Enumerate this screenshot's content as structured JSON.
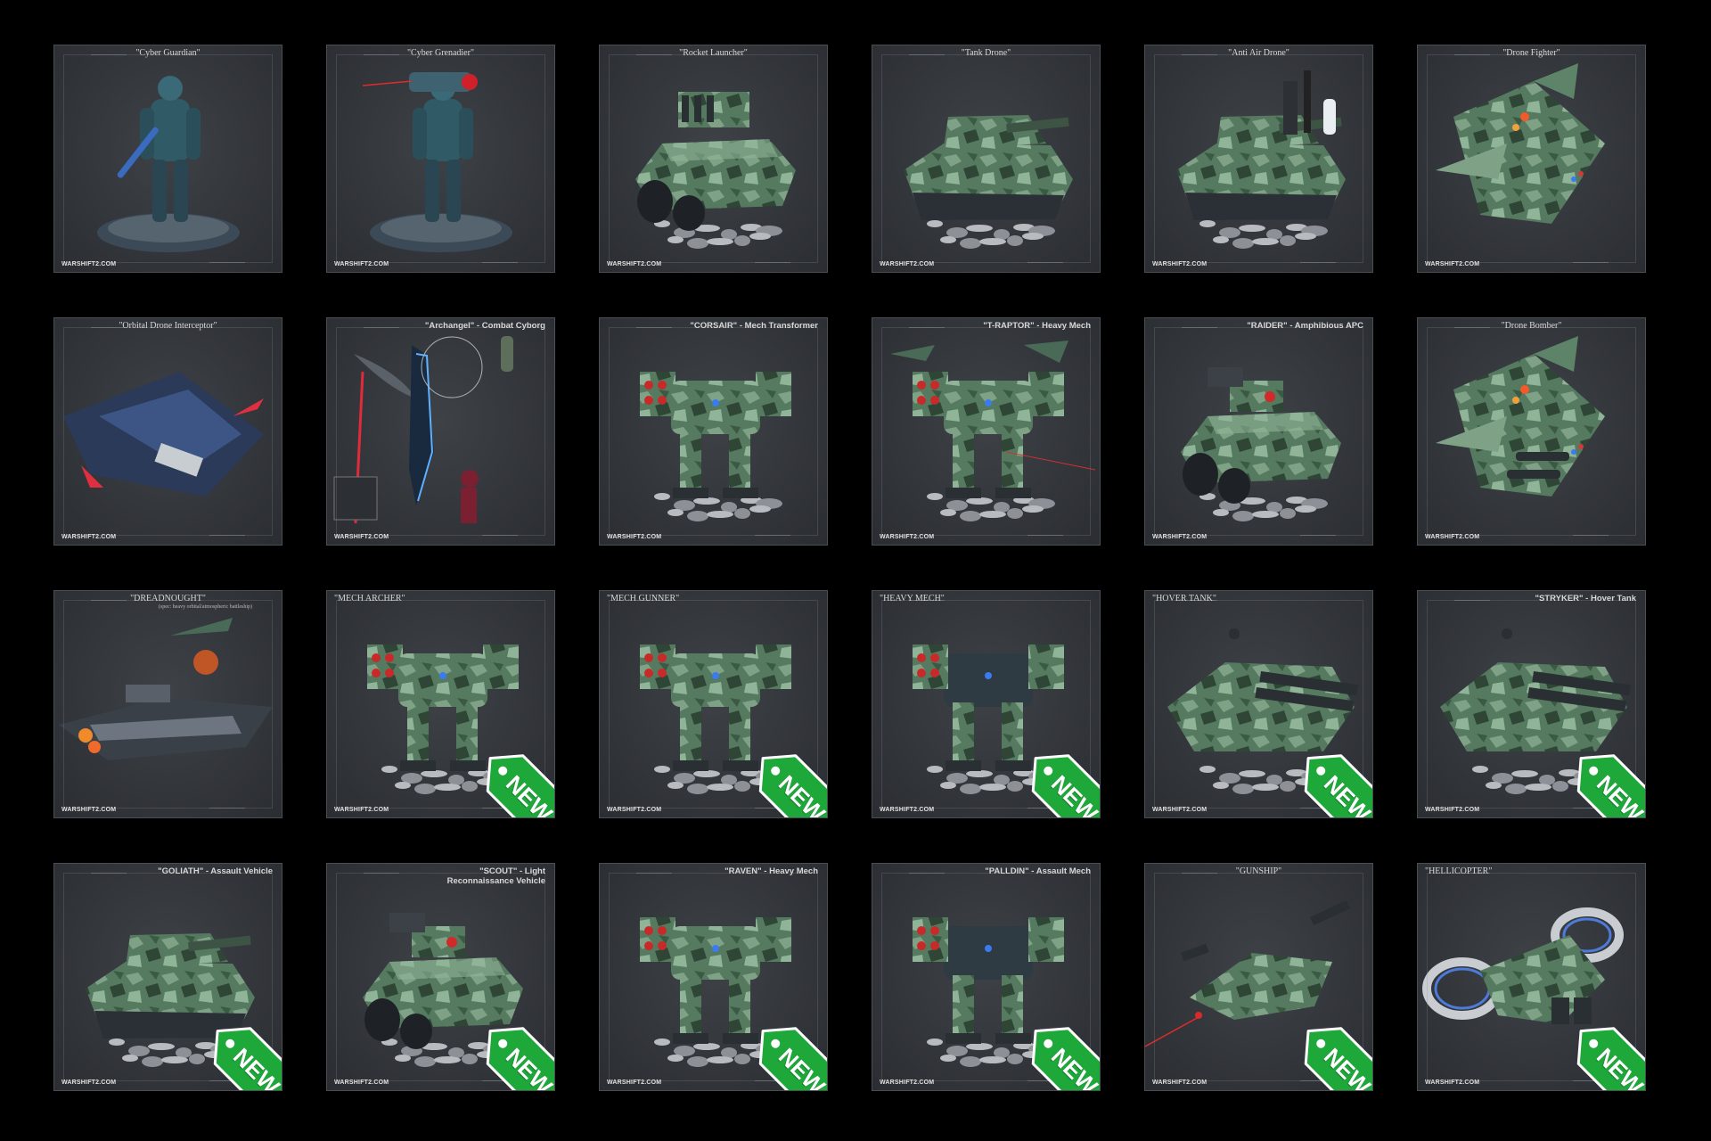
{
  "watermark": "WARSHIFT2.COM",
  "new_tag_label": "NEW",
  "colors": {
    "background": "#000000",
    "card": "#35383c",
    "camo_light": "#7fa287",
    "camo_dark": "#2f4636",
    "tag_green": "#1ea83a"
  },
  "cards": [
    {
      "title": "\"Cyber Guardian\"",
      "subject": "cyborg",
      "style": "serif",
      "is_new": false
    },
    {
      "title": "\"Cyber Grenadier\"",
      "subject": "cyborg-gun",
      "style": "serif",
      "is_new": false
    },
    {
      "title": "\"Rocket Launcher\"",
      "subject": "vehicle-rocket",
      "style": "serif",
      "is_new": false
    },
    {
      "title": "\"Tank Drone\"",
      "subject": "tank",
      "style": "serif",
      "is_new": false
    },
    {
      "title": "\"Anti Air Drone\"",
      "subject": "tank-aa",
      "style": "serif",
      "is_new": false
    },
    {
      "title": "\"Drone Fighter\"",
      "subject": "jet",
      "style": "serif",
      "is_new": false
    },
    {
      "title": "\"Orbital Drone Interceptor\"",
      "subject": "ship-dark",
      "style": "serif",
      "is_new": false
    },
    {
      "title": "\"Archangel\" - Combat Cyborg",
      "subject": "archangel",
      "style": "sans",
      "is_new": false
    },
    {
      "title": "\"CORSAIR\" - Mech Transformer",
      "subject": "mech",
      "style": "sans",
      "is_new": false
    },
    {
      "title": "\"T-RAPTOR\" - Heavy Mech",
      "subject": "raptor",
      "style": "sans",
      "is_new": false
    },
    {
      "title": "\"RAIDER\" - Amphibious APC",
      "subject": "apc",
      "style": "sans",
      "is_new": false
    },
    {
      "title": "\"Drone Bomber\"",
      "subject": "jet-bomber",
      "style": "serif",
      "is_new": false
    },
    {
      "title": "\"DREADNOUGHT\"",
      "subtitle": "(spec: heavy orbital/atmospheric battleship)",
      "subject": "dreadnought",
      "style": "serif",
      "is_new": false
    },
    {
      "title": "\"MECH ARCHER\"",
      "subject": "mech",
      "style": "serif-left",
      "is_new": true
    },
    {
      "title": "\"MECH GUNNER\"",
      "subject": "mech",
      "style": "serif-left",
      "is_new": true
    },
    {
      "title": "\"HEAVY MECH\"",
      "subject": "mech-heavy",
      "style": "serif-left",
      "is_new": true
    },
    {
      "title": "\"HOVER TANK\"",
      "subject": "hover",
      "style": "serif-left",
      "is_new": true
    },
    {
      "title": "\"STRYKER\" - Hover Tank",
      "subject": "hover",
      "style": "sans",
      "is_new": true
    },
    {
      "title": "\"GOLIATH\" - Assault Vehicle",
      "subject": "tank",
      "style": "sans",
      "is_new": true
    },
    {
      "title": "\"SCOUT\" - Light Reconnaissance Vehicle",
      "subject": "apc",
      "style": "sans",
      "is_new": true
    },
    {
      "title": "\"RAVEN\" - Heavy Mech",
      "subject": "mech",
      "style": "sans",
      "is_new": true
    },
    {
      "title": "\"PALLDIN\" - Assault Mech",
      "subject": "mech-heavy",
      "style": "sans",
      "is_new": true
    },
    {
      "title": "\"GUNSHIP\"",
      "subject": "gunship",
      "style": "serif",
      "is_new": true
    },
    {
      "title": "\"HELLICOPTER\"",
      "subject": "helicopter",
      "style": "serif-left",
      "is_new": true
    }
  ]
}
